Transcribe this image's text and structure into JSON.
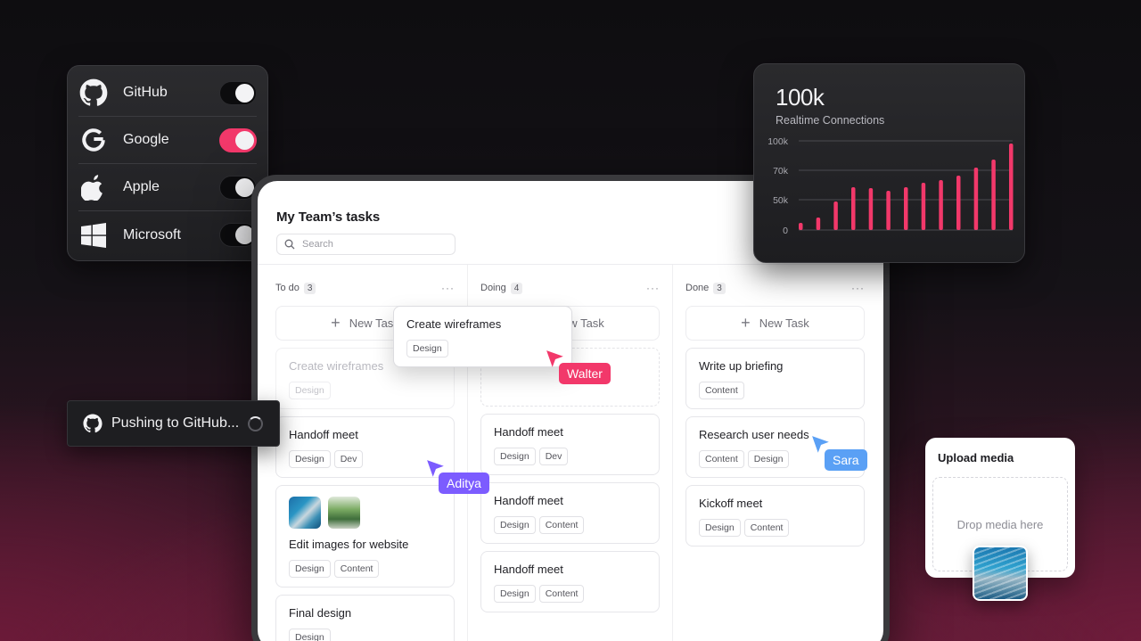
{
  "providers": [
    {
      "label": "GitHub",
      "icon": "github-icon",
      "enabled": false
    },
    {
      "label": "Google",
      "icon": "google-icon",
      "enabled": true
    },
    {
      "label": "Apple",
      "icon": "apple-icon",
      "enabled": false
    },
    {
      "label": "Microsoft",
      "icon": "microsoft-icon",
      "enabled": false
    }
  ],
  "toast": {
    "text": "Pushing to GitHub...",
    "icon": "github-icon"
  },
  "tasks": {
    "title": "My Team’s tasks",
    "search_placeholder": "Search",
    "new_task_label": "New Task",
    "columns": [
      {
        "name": "To do",
        "count": "3"
      },
      {
        "name": "Doing",
        "count": "4"
      },
      {
        "name": "Done",
        "count": "3"
      }
    ],
    "todo_cards": [
      {
        "title": "Create wireframes",
        "tags": [
          "Design"
        ]
      },
      {
        "title": "Handoff meet",
        "tags": [
          "Design",
          "Dev"
        ]
      },
      {
        "title": "Edit images for website",
        "tags": [
          "Design",
          "Content"
        ]
      },
      {
        "title": "Final design",
        "tags": [
          "Design"
        ]
      }
    ],
    "doing_cards": [
      {
        "title": "Handoff meet",
        "tags": [
          "Design",
          "Dev"
        ]
      },
      {
        "title": "Handoff meet",
        "tags": [
          "Design",
          "Content"
        ]
      },
      {
        "title": "Handoff meet",
        "tags": [
          "Design",
          "Content"
        ]
      }
    ],
    "done_cards": [
      {
        "title": "Write up briefing",
        "tags": [
          "Content"
        ]
      },
      {
        "title": "Research user needs",
        "tags": [
          "Content",
          "Design"
        ]
      },
      {
        "title": "Kickoff meet",
        "tags": [
          "Design",
          "Content"
        ]
      }
    ],
    "dragged_card": {
      "title": "Create wireframes",
      "tags": [
        "Design"
      ]
    }
  },
  "cursors": [
    {
      "name": "Walter",
      "color": "#f2386a"
    },
    {
      "name": "Aditya",
      "color": "#7c5cff"
    },
    {
      "name": "Sara",
      "color": "#5aa0f5"
    }
  ],
  "stats": {
    "value": "100k",
    "label": "Realtime Connections"
  },
  "chart_data": {
    "type": "bar",
    "y_ticks": [
      "100k",
      "70k",
      "50k",
      "0"
    ],
    "ylim": [
      0,
      100
    ],
    "values": [
      8,
      14,
      32,
      48,
      47,
      44,
      48,
      53,
      56,
      61,
      70,
      79,
      97
    ],
    "color": "#f2386a",
    "grid": true
  },
  "upload": {
    "title": "Upload media",
    "drop_text": "Drop media here"
  }
}
